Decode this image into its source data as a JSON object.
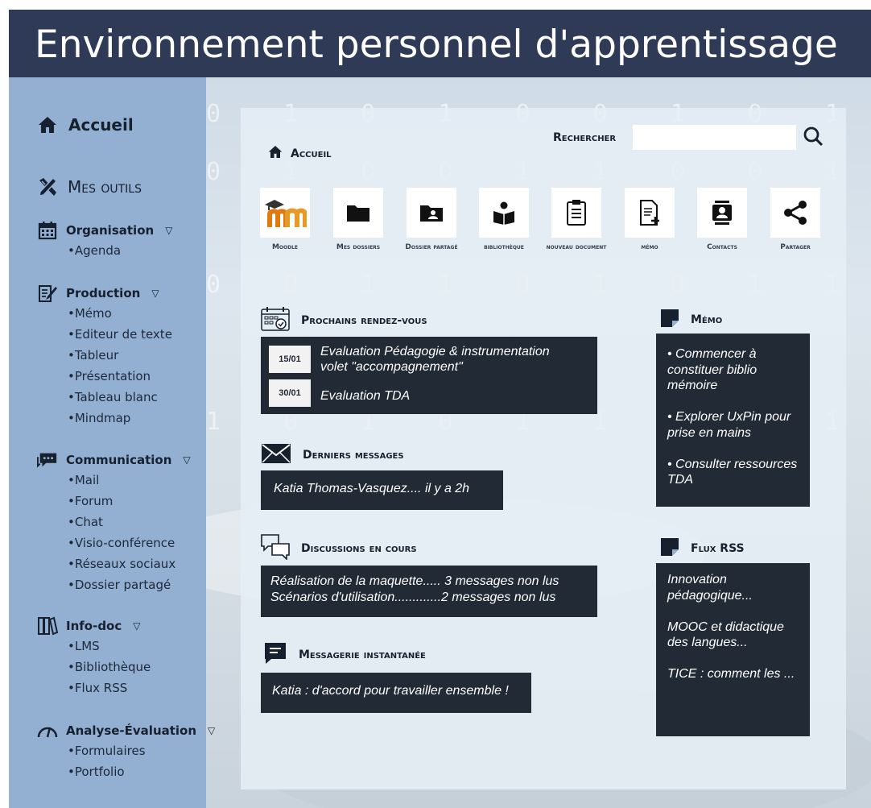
{
  "header": {
    "title": "Environnement personnel d'apprentissage"
  },
  "sidebar": {
    "home": {
      "label": "Accueil",
      "icon": "home-icon"
    },
    "tools": {
      "label": "Mes outils",
      "icon": "tools-icon"
    },
    "groups": [
      {
        "title": "Organisation",
        "icon": "calendar-icon",
        "items": [
          "•Agenda"
        ]
      },
      {
        "title": "Production",
        "icon": "writing-icon",
        "items": [
          "•Mémo",
          "•Editeur de texte",
          "•Tableur",
          "•Présentation",
          "•Tableau blanc",
          "•Mindmap"
        ]
      },
      {
        "title": "Communication",
        "icon": "chat-bubble-icon",
        "items": [
          "•Mail",
          "•Forum",
          "•Chat",
          "•Visio-conférence",
          "•Réseaux sociaux",
          "•Dossier partagé"
        ]
      },
      {
        "title": "Info-doc",
        "icon": "books-icon",
        "items": [
          "•LMS",
          "•Bibliothèque",
          "•Flux RSS"
        ]
      },
      {
        "title": "Analyse-Évaluation",
        "icon": "gauge-icon",
        "items": [
          "•Formulaires",
          "•Portfolio"
        ]
      }
    ],
    "expand_glyph": "▽"
  },
  "main": {
    "breadcrumb": "Accueil",
    "search": {
      "label": "Rechercher",
      "placeholder": ""
    },
    "tools": [
      {
        "label": "Moodle",
        "icon": "moodle-icon"
      },
      {
        "label": "Mes dossiers",
        "icon": "folder-icon"
      },
      {
        "label": "Dossier partagé",
        "icon": "shared-folder-icon"
      },
      {
        "label": "bibliothèque",
        "icon": "library-icon"
      },
      {
        "label": "nouveau document",
        "icon": "document-icon"
      },
      {
        "label": "mémo",
        "icon": "memo-icon"
      },
      {
        "label": "Contacts",
        "icon": "contacts-icon"
      },
      {
        "label": "Partager",
        "icon": "share-icon"
      }
    ],
    "appointments": {
      "title": "Prochains rendez-vous",
      "items": [
        {
          "date": "15/01",
          "text_line1": "Evaluation Pédagogie & instrumentation",
          "text_line2": "volet \"accompagnement\""
        },
        {
          "date": "30/01",
          "text_line1": "Evaluation TDA",
          "text_line2": ""
        }
      ]
    },
    "messages": {
      "title": "Derniers messages",
      "items": [
        "Katia Thomas-Vasquez.... il y a 2h"
      ]
    },
    "discussions": {
      "title": "Discussions en cours",
      "items": [
        "Réalisation de la maquette..... 3 messages non lus",
        "Scénarios d'utilisation.............2 messages non lus"
      ]
    },
    "instant": {
      "title": "Messagerie instantanée",
      "items": [
        "Katia : d'accord pour travailler ensemble !"
      ]
    },
    "memo": {
      "title": "Mémo",
      "items": [
        "• Commencer à constituer biblio mémoire",
        "• Explorer UxPin pour prise en mains",
        "• Consulter ressources TDA"
      ]
    },
    "rss": {
      "title": "Flux RSS",
      "items": [
        "Innovation pédagogique...",
        "MOOC et didactique des langues...",
        "TICE : comment les ..."
      ]
    }
  }
}
